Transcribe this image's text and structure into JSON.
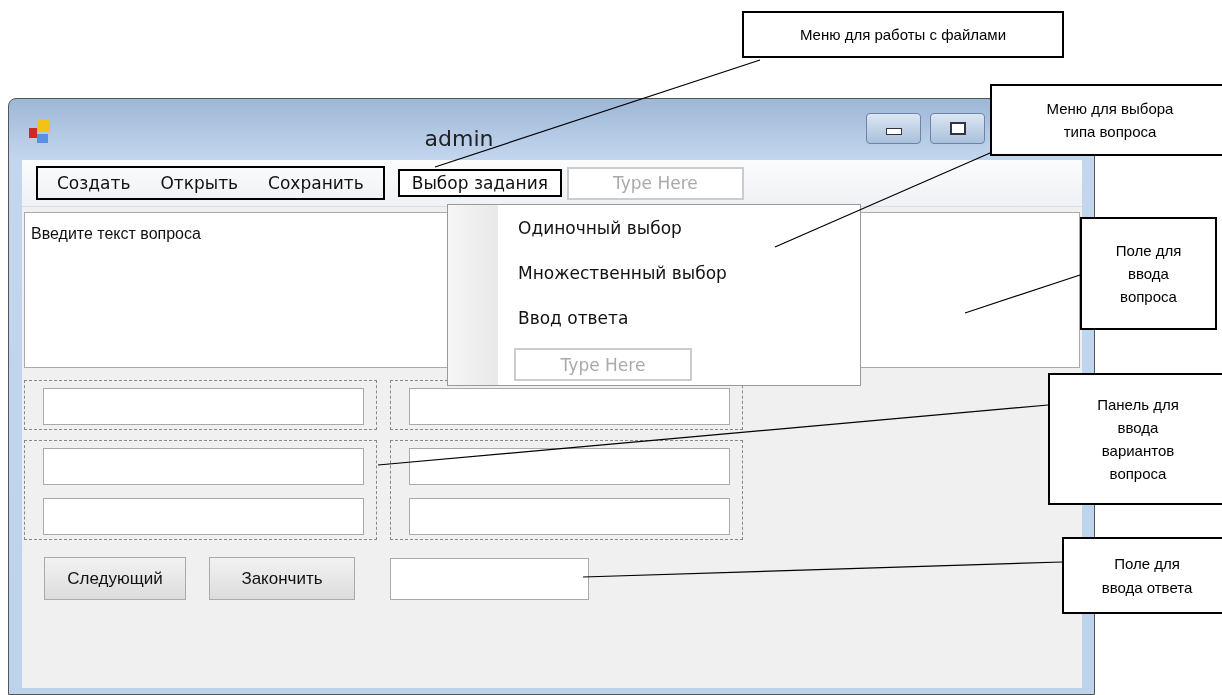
{
  "window": {
    "title": "admin"
  },
  "menu_bar": {
    "items": [
      {
        "label": "Создать",
        "selected": false
      },
      {
        "label": "Открыть",
        "selected": false
      },
      {
        "label": "Сохранить",
        "selected": false
      },
      {
        "label": "Выбор задания",
        "selected": true
      }
    ],
    "placeholder": "Type Here"
  },
  "dropdown": {
    "items": [
      {
        "label": "Одиночный выбор"
      },
      {
        "label": "Множественный выбор"
      },
      {
        "label": "Ввод ответа"
      }
    ],
    "placeholder": "Type Here"
  },
  "question_field": {
    "value": "Введите текст вопроса"
  },
  "buttons": [
    "Следующий",
    "Закончить"
  ],
  "annotations": [
    {
      "text": "Меню для работы с файлами"
    },
    {
      "text": "Меню для выбора типа вопроса"
    },
    {
      "text": "Поле для ввода вопроса"
    },
    {
      "text": "Панель для ввода вариантов вопроса"
    },
    {
      "text": "Поле для ввода ответа"
    }
  ]
}
